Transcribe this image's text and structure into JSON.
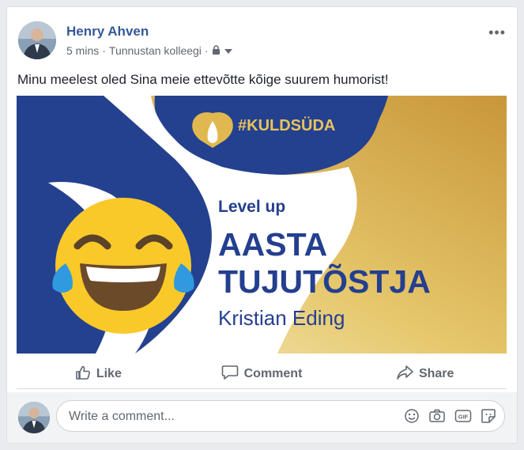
{
  "post": {
    "author": "Henry Ahven",
    "time": "5 mins",
    "separator": "·",
    "audience": "Tunnustan kolleegi",
    "text": "Minu meelest oled Sina meie ettevõtte kõige suurem humorist!",
    "more_label": "•••"
  },
  "banner": {
    "hashtag": "#KULDSÜDA",
    "level": "Level up",
    "title_line1": "AASTA",
    "title_line2": "TUJUTÕSTJA",
    "name": "Kristian Eding",
    "colors": {
      "navy": "#24418f",
      "gold": "#d5a843",
      "text": "#243f8f",
      "emoji": "#f9c92a"
    }
  },
  "actions": {
    "like": "Like",
    "comment": "Comment",
    "share": "Share"
  },
  "comment": {
    "placeholder": "Write a comment..."
  },
  "icons": {
    "emoji": "smiley-icon",
    "camera": "camera-icon",
    "gif": "gif-icon",
    "sticker": "sticker-icon"
  }
}
